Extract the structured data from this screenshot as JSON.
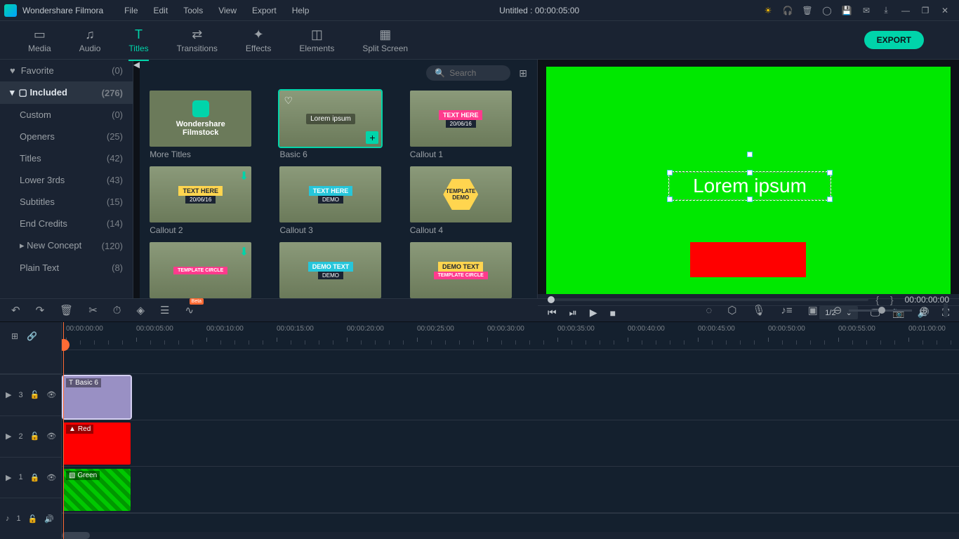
{
  "app": {
    "name": "Wondershare Filmora",
    "title_center": "Untitled : 00:00:05:00"
  },
  "menu": [
    "File",
    "Edit",
    "Tools",
    "View",
    "Export",
    "Help"
  ],
  "ribbon": {
    "tabs": [
      "Media",
      "Audio",
      "Titles",
      "Transitions",
      "Effects",
      "Elements",
      "Split Screen"
    ],
    "active": 2,
    "export": "EXPORT"
  },
  "sidebar": {
    "favorite": {
      "label": "Favorite",
      "count": "(0)"
    },
    "included": {
      "label": "Included",
      "count": "(276)"
    },
    "items": [
      {
        "label": "Custom",
        "count": "(0)"
      },
      {
        "label": "Openers",
        "count": "(25)"
      },
      {
        "label": "Titles",
        "count": "(42)"
      },
      {
        "label": "Lower 3rds",
        "count": "(43)"
      },
      {
        "label": "Subtitles",
        "count": "(15)"
      },
      {
        "label": "End Credits",
        "count": "(14)"
      },
      {
        "label": "New Concept",
        "count": "(120)",
        "expandable": true
      },
      {
        "label": "Plain Text",
        "count": "(8)"
      }
    ]
  },
  "browser": {
    "search_placeholder": "Search",
    "cards": [
      {
        "label": "More Titles",
        "type": "black",
        "line1": "Wondershare",
        "line2": "Filmstock"
      },
      {
        "label": "Basic 6",
        "type": "selected",
        "overlay": "Lorem ipsum"
      },
      {
        "label": "Callout 1",
        "type": "pink",
        "text": "TEXT HERE",
        "date": "20/06/16"
      },
      {
        "label": "Callout 2",
        "type": "yellow",
        "text": "TEXT HERE",
        "date": "20/06/16",
        "dl": true
      },
      {
        "label": "Callout 3",
        "type": "cyan",
        "text": "TEXT HERE",
        "sub": "DEMO"
      },
      {
        "label": "Callout 4",
        "type": "hex",
        "text": "TEMPLATE",
        "sub": "DEMO"
      },
      {
        "label": "",
        "type": "pink2",
        "text": "TEMPLATE CIRCLE",
        "dl": true
      },
      {
        "label": "",
        "type": "cyan2",
        "text": "DEMO TEXT",
        "sub": "DEMO"
      },
      {
        "label": "",
        "type": "yellow2",
        "text": "DEMO TEXT",
        "sub": "TEMPLATE CIRCLE"
      }
    ]
  },
  "preview": {
    "text": "Lorem ipsum",
    "timecode": "00:00:00:00",
    "ratio": "1/2"
  },
  "timeline": {
    "ticks": [
      "00:00:00:00",
      "00:00:05:00",
      "00:00:10:00",
      "00:00:15:00",
      "00:00:20:00",
      "00:00:25:00",
      "00:00:30:00",
      "00:00:35:00",
      "00:00:40:00",
      "00:00:45:00",
      "00:00:50:00",
      "00:00:55:00",
      "00:01:00:00"
    ],
    "tracks": [
      {
        "id": "3",
        "clip": "Basic 6",
        "type": "purple"
      },
      {
        "id": "2",
        "clip": "Red",
        "type": "red"
      },
      {
        "id": "1",
        "clip": "Green",
        "type": "green",
        "locked": true
      }
    ],
    "audio_id": "1"
  },
  "beta": "Beta"
}
